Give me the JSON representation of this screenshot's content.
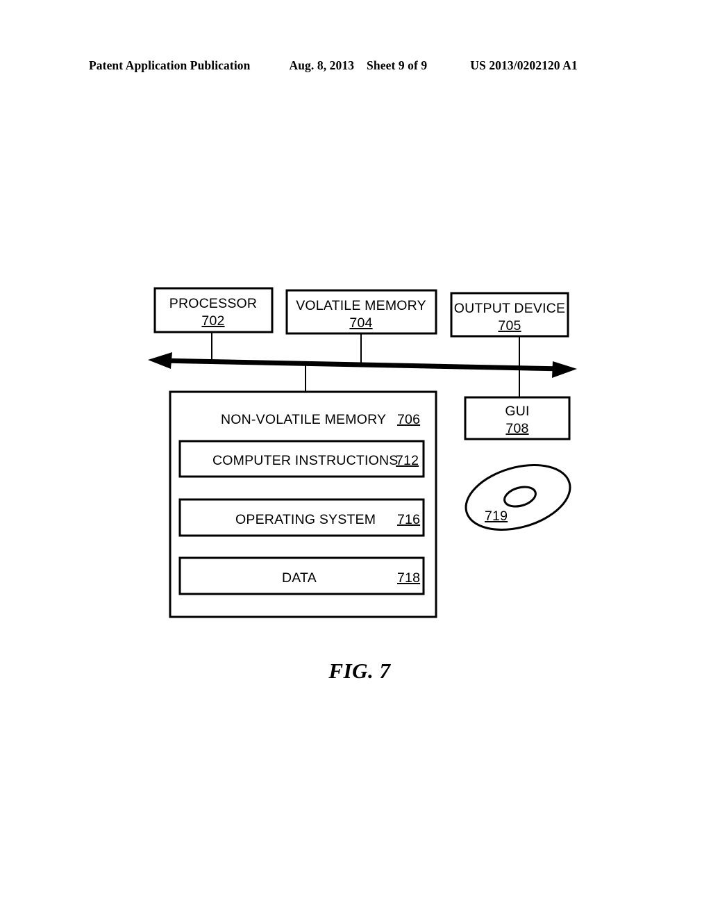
{
  "header": {
    "publication": "Patent Application Publication",
    "date": "Aug. 8, 2013",
    "sheet": "Sheet 9 of 9",
    "patent_number": "US 2013/0202120 A1"
  },
  "figure": {
    "caption": "FIG. 7",
    "boxes": {
      "processor": {
        "label": "PROCESSOR",
        "ref": "702"
      },
      "volatile_memory": {
        "label": "VOLATILE MEMORY",
        "ref": "704"
      },
      "output_device": {
        "label": "OUTPUT DEVICE",
        "ref": "705"
      },
      "non_volatile_memory": {
        "label": "NON-VOLATILE MEMORY",
        "ref": "706"
      },
      "computer_instructions": {
        "label": "COMPUTER INSTRUCTIONS",
        "ref": "712"
      },
      "operating_system": {
        "label": "OPERATING SYSTEM",
        "ref": "716"
      },
      "data": {
        "label": "DATA",
        "ref": "718"
      },
      "gui": {
        "label": "GUI",
        "ref": "708"
      },
      "optical_disc": {
        "label": "",
        "ref": "719"
      }
    },
    "colors": {
      "ink": "#000000",
      "paper": "#ffffff"
    }
  }
}
